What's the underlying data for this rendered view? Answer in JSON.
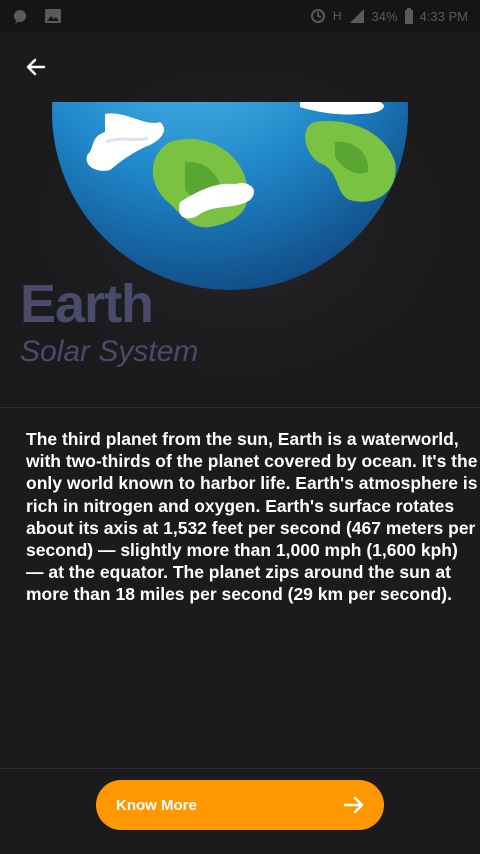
{
  "status_bar": {
    "network": "H",
    "battery": "34%",
    "time": "4:33 PM"
  },
  "header": {
    "back_icon": "arrow-left-icon",
    "title": "Earth",
    "subtitle": "Solar System"
  },
  "content": {
    "description": "The third planet from the sun, Earth is a waterworld, with two-thirds of the planet covered by ocean. It's the only world known to harbor life. Earth's atmosphere is rich in nitrogen and oxygen. Earth's surface rotates about its axis at 1,532 feet per second (467 meters per second) — slightly more than 1,000 mph (1,600 kph) — at the equator. The planet zips around the sun at more than 18 miles per second (29 km per second)."
  },
  "footer": {
    "know_more_label": "Know More",
    "arrow_icon": "arrow-right-icon",
    "button_color": "#ff9800"
  },
  "colors": {
    "background": "#1b1b1d",
    "title": "#4a4a6a",
    "accent": "#ff9800"
  }
}
